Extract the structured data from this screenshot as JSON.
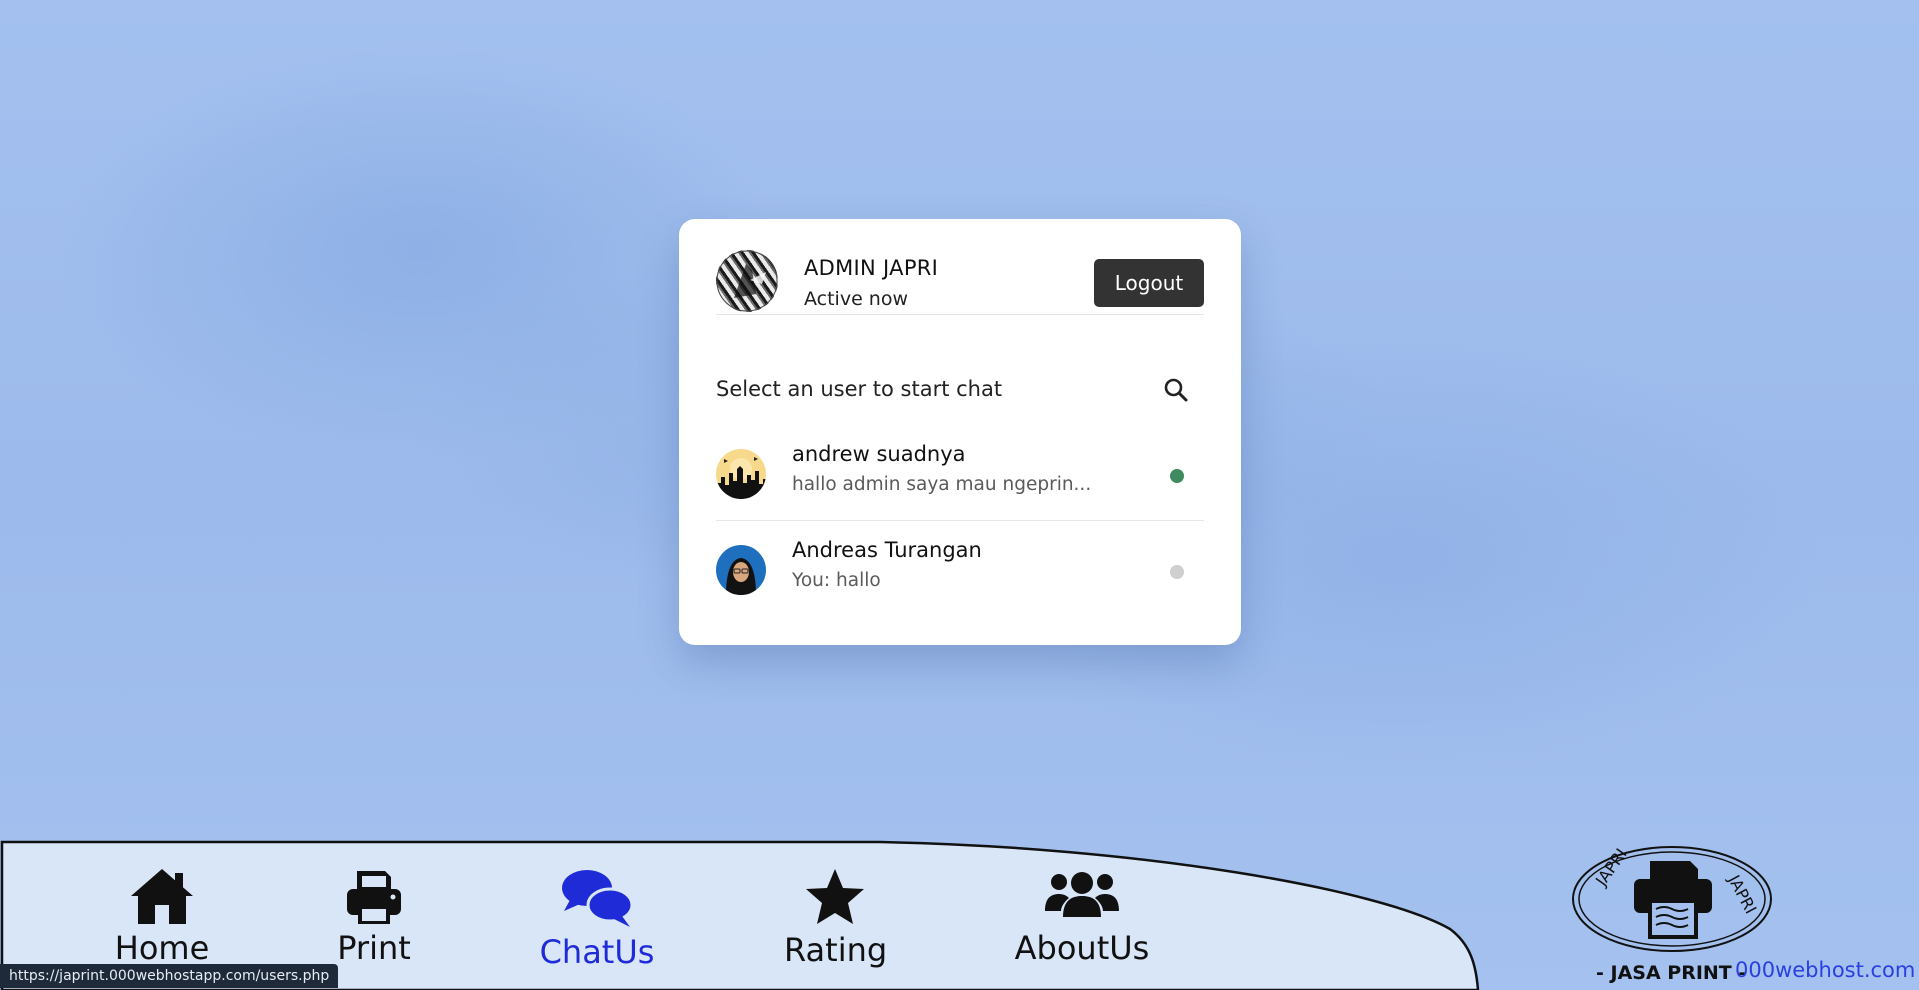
{
  "card": {
    "admin_name": "ADMIN JAPRI",
    "admin_status": "Active now",
    "logout_label": "Logout",
    "search_prompt": "Select an user to start chat",
    "users": [
      {
        "name": "andrew suadnya",
        "last_message": "hallo admin saya mau ngeprin...",
        "status": "online"
      },
      {
        "name": "Andreas Turangan",
        "last_message": "You: hallo",
        "status": "offline"
      }
    ]
  },
  "nav": {
    "items": [
      {
        "label": "Home",
        "icon": "home-icon"
      },
      {
        "label": "Print",
        "icon": "printer-icon"
      },
      {
        "label": "ChatUs",
        "icon": "comments-icon",
        "active": true
      },
      {
        "label": "Rating",
        "icon": "star-icon"
      },
      {
        "label": "AboutUs",
        "icon": "users-icon"
      }
    ],
    "active_color": "#1e2bd6"
  },
  "logo": {
    "ring_text_left": "JAPRI",
    "ring_text_right": "JAPRI",
    "tagline": "- JASA PRINT -"
  },
  "host_text": "000webhost.com",
  "status_url": "https://japrint.000webhostapp.com/users.php",
  "colors": {
    "online": "#3f8a5f",
    "offline": "#cfcfcf",
    "logout_bg": "#333333"
  }
}
